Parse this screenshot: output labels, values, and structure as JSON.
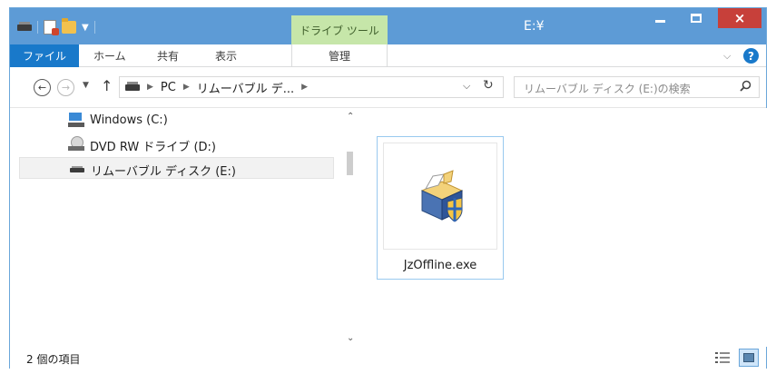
{
  "window": {
    "title": "E:¥",
    "context_tab": "ドライブ ツール",
    "close_glyph": "×"
  },
  "ribbon": {
    "tabs": {
      "file": "ファイル",
      "home": "ホーム",
      "share": "共有",
      "view": "表示",
      "manage": "管理"
    },
    "help_glyph": "?"
  },
  "navigation": {
    "breadcrumb": [
      "PC",
      "リムーバブル デ..."
    ],
    "search_placeholder": "リムーバブル ディスク (E:)の検索"
  },
  "nav_pane": {
    "items": [
      {
        "label": "Windows (C:)",
        "icon": "windows-drive-icon",
        "selected": false
      },
      {
        "label": "DVD RW ドライブ (D:)",
        "icon": "dvd-drive-icon",
        "selected": false
      },
      {
        "label": "リムーバブル ディスク (E:)",
        "icon": "removable-drive-icon",
        "selected": true
      }
    ]
  },
  "content": {
    "files": [
      {
        "name": "JzOffline.exe",
        "icon": "setup-installer-icon"
      }
    ]
  },
  "status": {
    "item_count": "2 個の項目"
  },
  "colors": {
    "title_bar": "#5d9bd6",
    "file_tab": "#1979ca",
    "context_tab": "#c6e6a9",
    "close_button": "#c7403a",
    "selection_border": "#99c9ef"
  }
}
